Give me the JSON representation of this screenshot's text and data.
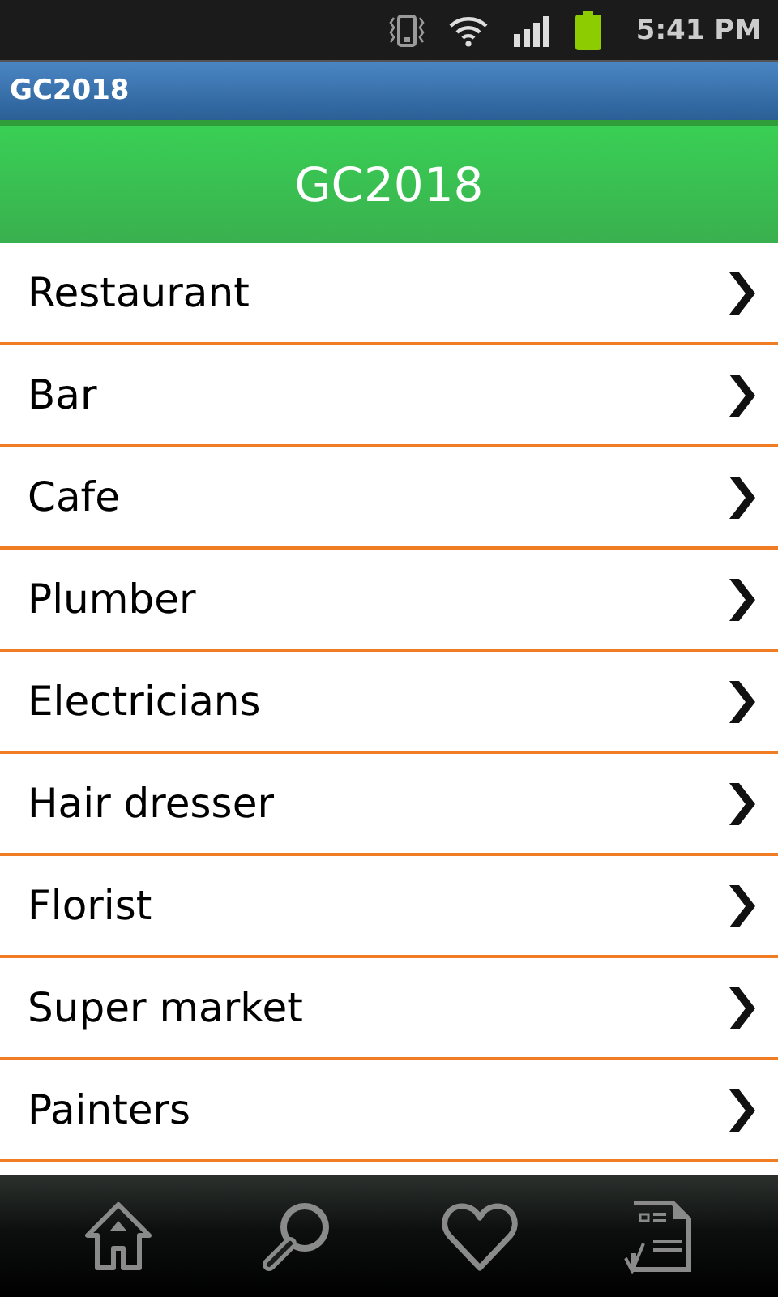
{
  "status_bar": {
    "time": "5:41 PM"
  },
  "window": {
    "title": "GC2018"
  },
  "header": {
    "title": "GC2018"
  },
  "list": {
    "items": [
      {
        "label": "Restaurant"
      },
      {
        "label": "Bar"
      },
      {
        "label": "Cafe"
      },
      {
        "label": "Plumber"
      },
      {
        "label": "Electricians"
      },
      {
        "label": "Hair dresser"
      },
      {
        "label": "Florist"
      },
      {
        "label": "Super market"
      },
      {
        "label": "Painters"
      }
    ]
  }
}
